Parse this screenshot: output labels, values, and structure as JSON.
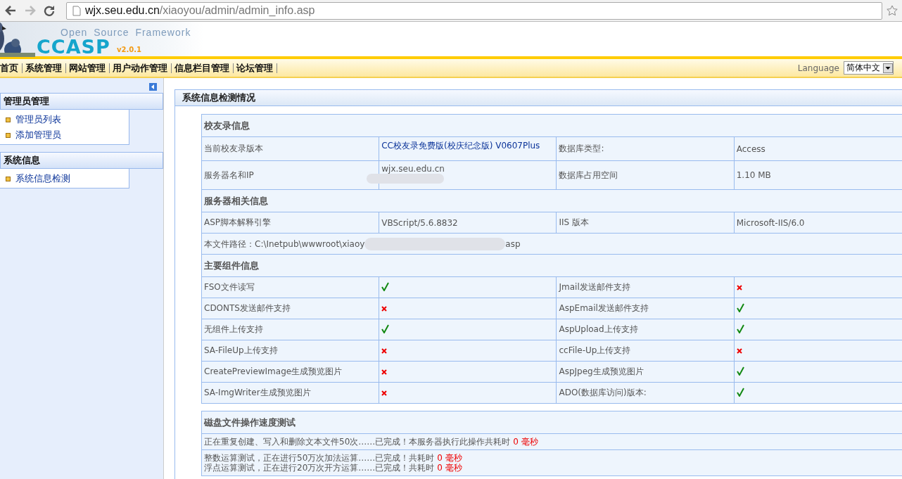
{
  "browser": {
    "url_host": "wjx.seu.edu.cn",
    "url_path": "/xiaoyou/admin/admin_info.asp"
  },
  "logo": {
    "tagline": "Open Source Framework",
    "name": "CCASP",
    "version": "v2.0.1"
  },
  "nav": {
    "items": [
      "首页",
      "系统管理",
      "网站管理",
      "用户动作管理",
      "信息栏目管理",
      "论坛管理"
    ],
    "language_label": "Language",
    "language_value": "简体中文"
  },
  "sidebar": {
    "groups": [
      {
        "title": "管理员管理",
        "items": [
          "管理员列表",
          "添加管理员"
        ]
      },
      {
        "title": "系统信息",
        "items": [
          "系统信息检测"
        ]
      }
    ]
  },
  "panel": {
    "title": "系统信息检测情况",
    "alumni": {
      "title": "校友录信息",
      "rows": [
        {
          "label": "当前校友录版本",
          "value": "CC校友录免费版(校庆纪念版) V0607Plus",
          "value_link": true,
          "label2": "数据库类型:",
          "value2": "Access",
          "redacted": false
        },
        {
          "label": "服务器名和IP",
          "value": "wjx.seu.edu.cn",
          "value_link": false,
          "label2": "数据库占用空间",
          "value2": "1.10 MB",
          "redacted": true
        }
      ]
    },
    "server": {
      "title": "服务器相关信息",
      "rows": [
        {
          "label": "ASP脚本解释引擎",
          "value": "VBScript/5.6.8832",
          "value_link": false,
          "label2": "IIS 版本",
          "value2": "Microsoft-IIS/6.0",
          "redacted": false
        }
      ],
      "path_start": "本文件路径：C:\\Inetpub\\wwwroot\\xiaoy",
      "path_end": "asp"
    },
    "components": {
      "title": "主要组件信息",
      "rows": [
        {
          "name": "FSO文件读写",
          "supported": true,
          "name2": "Jmail发送邮件支持",
          "supported2": false
        },
        {
          "name": "CDONTS发送邮件支持",
          "supported": false,
          "name2": "AspEmail发送邮件支持",
          "supported2": true
        },
        {
          "name": "无组件上传支持",
          "supported": true,
          "name2": "AspUpload上传支持",
          "supported2": true
        },
        {
          "name": "SA-FileUp上传支持",
          "supported": false,
          "name2": "ccFile-Up上传支持",
          "supported2": false
        },
        {
          "name": "CreatePreviewImage生成预览图片",
          "supported": false,
          "name2": "AspJpeg生成预览图片",
          "supported2": true
        },
        {
          "name": "SA-ImgWriter生成预览图片",
          "supported": false,
          "name2": "ADO(数据库访问)版本:",
          "supported2": true
        }
      ]
    },
    "speed": {
      "title": "磁盘文件操作速度测试",
      "groups": [
        [
          {
            "text": "正在重复创建、写入和删除文本文件50次……已完成！本服务器执行此操作共耗时",
            "result": "0 毫秒"
          }
        ],
        [
          {
            "text": "整数运算测试，正在进行50万次加法运算……已完成！共耗时",
            "result": "0 毫秒"
          },
          {
            "text": "浮点运算测试，正在进行20万次开方运算……已完成！共耗时",
            "result": "0 毫秒"
          }
        ]
      ]
    }
  }
}
